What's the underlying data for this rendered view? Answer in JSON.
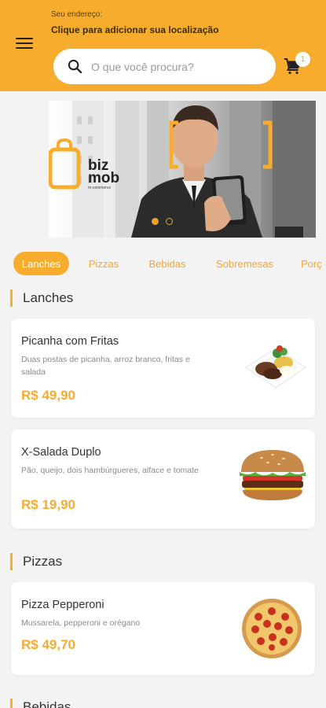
{
  "header": {
    "address_label": "Seu endereço:",
    "address_value": "Clique para adicionar sua localização",
    "search_placeholder": "O que você procura?",
    "cart_count": "1",
    "brand_color": "#f8ac2e"
  },
  "icons": {
    "menu": "hamburger-menu-icon",
    "search": "search-icon",
    "cart": "cart-icon"
  },
  "banner": {
    "logo_line1": "biz",
    "logo_line2": "mob",
    "logo_tagline": "m-commerce",
    "slides": 2,
    "active_slide": 1
  },
  "tabs": [
    "Lanches",
    "Pizzas",
    "Bebidas",
    "Sobremesas",
    "Porç"
  ],
  "sections": [
    {
      "title": "Lanches",
      "items": [
        {
          "name": "Picanha com Fritas",
          "description": "Duas postas de picanha, arroz branco, fritas e salada",
          "price": "R$ 49,90",
          "image": "picanha-plate-image"
        },
        {
          "name": "X-Salada Duplo",
          "description": "Pão, queijo, dois hambúrgueres, alface e tomate",
          "price": "R$ 19,90",
          "image": "burger-image"
        }
      ]
    },
    {
      "title": "Pizzas",
      "items": [
        {
          "name": "Pizza Pepperoni",
          "description": "Mussarela, pepperoni e orégano",
          "price": "R$ 49,70",
          "image": "pizza-image"
        }
      ]
    },
    {
      "title": "Bebidas",
      "items": []
    }
  ]
}
